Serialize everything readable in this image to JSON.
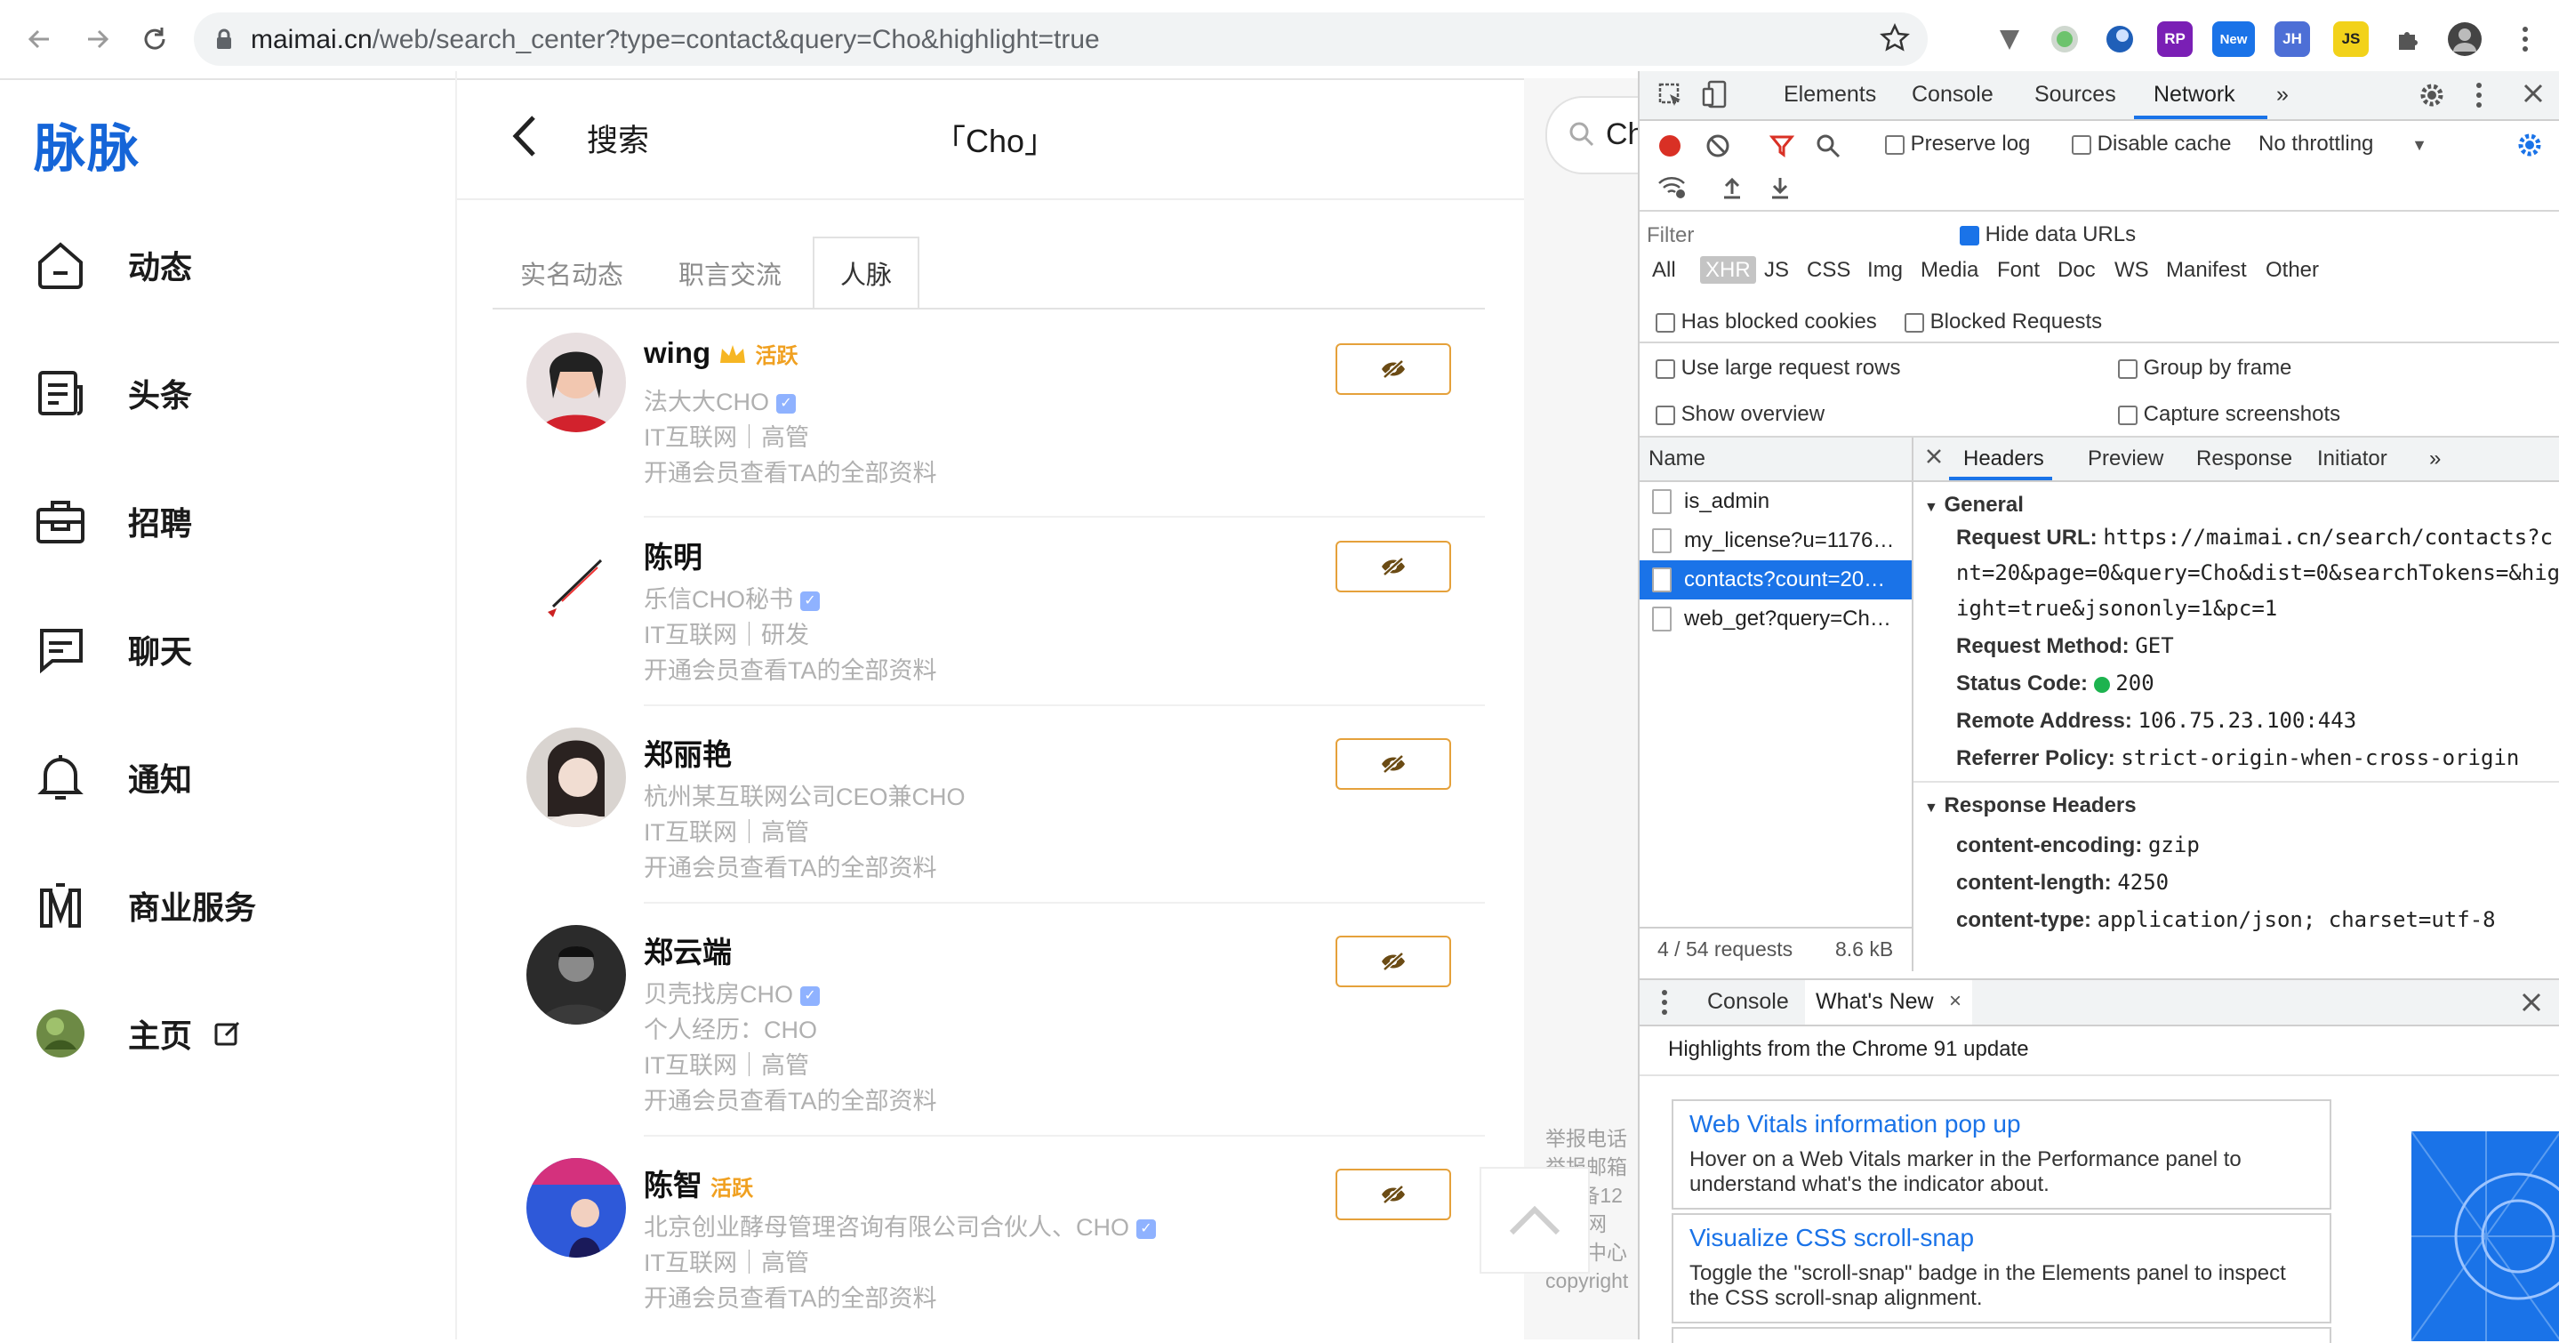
{
  "browser": {
    "url_host": "maimai.cn",
    "url_path": "/web/search_center?type=contact&query=Cho&highlight=true",
    "ext_labels": {
      "rp": "RP",
      "new": "New",
      "jh": "JH",
      "js": "JS"
    }
  },
  "sidebar": {
    "logo": "脉脉",
    "items": [
      {
        "label": "动态",
        "icon": "home-icon"
      },
      {
        "label": "头条",
        "icon": "news-icon"
      },
      {
        "label": "招聘",
        "icon": "briefcase-icon"
      },
      {
        "label": "聊天",
        "icon": "chat-icon"
      },
      {
        "label": "通知",
        "icon": "bell-icon"
      },
      {
        "label": "商业服务",
        "icon": "business-icon"
      },
      {
        "label": "主页",
        "icon": "avatar"
      }
    ]
  },
  "main": {
    "title": "搜索",
    "query": "「Cho」",
    "tabs": [
      "实名动态",
      "职言交流",
      "人脉"
    ],
    "active_tab": "人脉",
    "results": [
      {
        "name": "wing",
        "active": "活跃",
        "crown": true,
        "verified": true,
        "title": "法大大CHO",
        "lines": [
          "IT互联网｜高管",
          "开通会员查看TA的全部资料"
        ]
      },
      {
        "name": "陈明",
        "active": "",
        "crown": false,
        "verified": true,
        "title": "乐信CHO秘书",
        "lines": [
          "IT互联网｜研发",
          "开通会员查看TA的全部资料"
        ]
      },
      {
        "name": "郑丽艳",
        "active": "",
        "crown": false,
        "verified": false,
        "title": "杭州某互联网公司CEO兼CHO",
        "lines": [
          "IT互联网｜高管",
          "开通会员查看TA的全部资料"
        ]
      },
      {
        "name": "郑云端",
        "active": "",
        "crown": false,
        "verified": true,
        "title": "贝壳找房CHO",
        "lines": [
          "个人经历：CHO",
          "IT互联网｜高管",
          "开通会员查看TA的全部资料"
        ]
      },
      {
        "name": "陈智",
        "active": "活跃",
        "crown": false,
        "verified": true,
        "title": "北京创业酵母管理咨询有限公司合伙人、CHO",
        "lines": [
          "IT互联网｜高管",
          "开通会员查看TA的全部资料"
        ]
      }
    ],
    "search_partial": "Ch",
    "footer_partial": [
      "举报电话",
      "举报邮箱",
      "ICP备12",
      "京公网",
      "举报中心",
      "copyright"
    ]
  },
  "devtools": {
    "tabs": [
      "Elements",
      "Console",
      "Sources",
      "Network"
    ],
    "active_tab": "Network",
    "preserve_log": "Preserve log",
    "disable_cache": "Disable cache",
    "throttling": "No throttling",
    "filter_placeholder": "Filter",
    "hide_data_urls": "Hide data URLs",
    "types": [
      "All",
      "XHR",
      "JS",
      "CSS",
      "Img",
      "Media",
      "Font",
      "Doc",
      "WS",
      "Manifest",
      "Other"
    ],
    "has_blocked_cookies": "Has blocked cookies",
    "blocked_requests": "Blocked Requests",
    "use_large_rows": "Use large request rows",
    "group_by_frame": "Group by frame",
    "show_overview": "Show overview",
    "capture_screenshots": "Capture screenshots",
    "name_header": "Name",
    "requests": [
      "is_admin",
      "my_license?u=1176…",
      "contacts?count=20…",
      "web_get?query=Ch…"
    ],
    "selected_request": 2,
    "status_requests": "4 / 54 requests",
    "status_size": "8.6 kB",
    "detail_tabs": [
      "Headers",
      "Preview",
      "Response",
      "Initiator"
    ],
    "general_title": "General",
    "general": {
      "request_url_label": "Request URL:",
      "request_url_1": "https://maimai.cn/search/contacts?c",
      "request_url_2": "nt=20&page=0&query=Cho&dist=0&searchTokens=&hig",
      "request_url_3": "ight=true&jsononly=1&pc=1",
      "method_label": "Request Method:",
      "method": "GET",
      "status_label": "Status Code:",
      "status": "200",
      "remote_label": "Remote Address:",
      "remote": "106.75.23.100:443",
      "referrer_label": "Referrer Policy:",
      "referrer": "strict-origin-when-cross-origin"
    },
    "response_headers_title": "Response Headers",
    "response_headers": [
      {
        "k": "content-encoding:",
        "v": "gzip"
      },
      {
        "k": "content-length:",
        "v": "4250"
      },
      {
        "k": "content-type:",
        "v": "application/json; charset=utf-8"
      }
    ],
    "drawer_tabs": [
      "Console",
      "What's New"
    ],
    "drawer_subtitle": "Highlights from the Chrome 91 update",
    "whats_new": [
      {
        "title": "Web Vitals information pop up",
        "desc": "Hover on a Web Vitals marker in the Performance panel to understand what's the indicator about."
      },
      {
        "title": "Visualize CSS scroll-snap",
        "desc": "Toggle the \"scroll-snap\" badge in the Elements panel to inspect the CSS scroll-snap alignment."
      }
    ]
  }
}
